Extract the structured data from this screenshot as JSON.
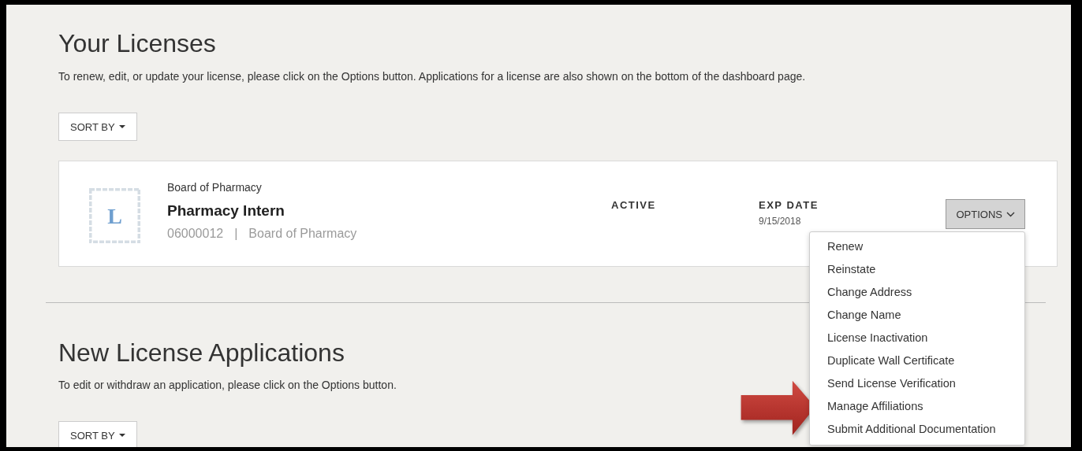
{
  "licenses": {
    "title": "Your Licenses",
    "description": "To renew, edit, or update your license, please click on the Options button. Applications for a license are also shown on the bottom of the dashboard page.",
    "sort_button": "SORT BY",
    "cards": [
      {
        "badge_letter": "L",
        "board": "Board of Pharmacy",
        "name": "Pharmacy Intern",
        "number": "06000012",
        "separator": "|",
        "board_name": "Board of Pharmacy",
        "status": "ACTIVE",
        "exp_label": "EXP DATE",
        "exp_date": "9/15/2018",
        "options_button": "OPTIONS",
        "expanded": true,
        "menu": [
          "Renew",
          "Reinstate",
          "Change Address",
          "Change Name",
          "License Inactivation",
          "Duplicate Wall Certificate",
          "Send License Verification",
          "Manage Affiliations",
          "Submit Additional Documentation"
        ]
      }
    ]
  },
  "applications": {
    "title": "New License Applications",
    "description": "To edit or withdraw an application, please click on the Options button.",
    "sort_button": "SORT BY"
  }
}
